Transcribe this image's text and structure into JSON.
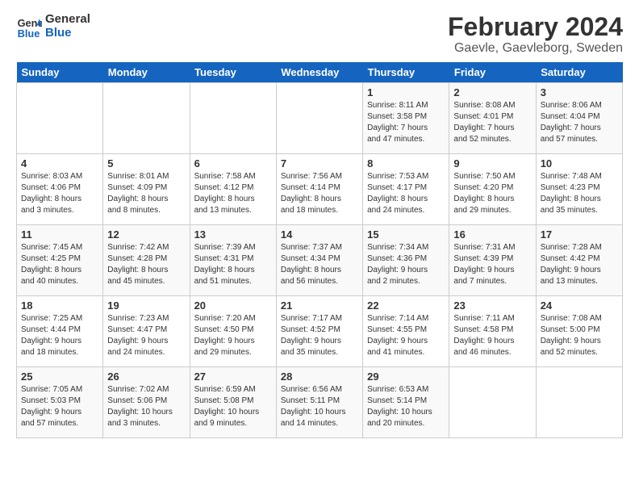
{
  "header": {
    "logo_line1": "General",
    "logo_line2": "Blue",
    "month": "February 2024",
    "location": "Gaevle, Gaevleborg, Sweden"
  },
  "weekdays": [
    "Sunday",
    "Monday",
    "Tuesday",
    "Wednesday",
    "Thursday",
    "Friday",
    "Saturday"
  ],
  "weeks": [
    [
      {
        "day": "",
        "info": ""
      },
      {
        "day": "",
        "info": ""
      },
      {
        "day": "",
        "info": ""
      },
      {
        "day": "",
        "info": ""
      },
      {
        "day": "1",
        "info": "Sunrise: 8:11 AM\nSunset: 3:58 PM\nDaylight: 7 hours\nand 47 minutes."
      },
      {
        "day": "2",
        "info": "Sunrise: 8:08 AM\nSunset: 4:01 PM\nDaylight: 7 hours\nand 52 minutes."
      },
      {
        "day": "3",
        "info": "Sunrise: 8:06 AM\nSunset: 4:04 PM\nDaylight: 7 hours\nand 57 minutes."
      }
    ],
    [
      {
        "day": "4",
        "info": "Sunrise: 8:03 AM\nSunset: 4:06 PM\nDaylight: 8 hours\nand 3 minutes."
      },
      {
        "day": "5",
        "info": "Sunrise: 8:01 AM\nSunset: 4:09 PM\nDaylight: 8 hours\nand 8 minutes."
      },
      {
        "day": "6",
        "info": "Sunrise: 7:58 AM\nSunset: 4:12 PM\nDaylight: 8 hours\nand 13 minutes."
      },
      {
        "day": "7",
        "info": "Sunrise: 7:56 AM\nSunset: 4:14 PM\nDaylight: 8 hours\nand 18 minutes."
      },
      {
        "day": "8",
        "info": "Sunrise: 7:53 AM\nSunset: 4:17 PM\nDaylight: 8 hours\nand 24 minutes."
      },
      {
        "day": "9",
        "info": "Sunrise: 7:50 AM\nSunset: 4:20 PM\nDaylight: 8 hours\nand 29 minutes."
      },
      {
        "day": "10",
        "info": "Sunrise: 7:48 AM\nSunset: 4:23 PM\nDaylight: 8 hours\nand 35 minutes."
      }
    ],
    [
      {
        "day": "11",
        "info": "Sunrise: 7:45 AM\nSunset: 4:25 PM\nDaylight: 8 hours\nand 40 minutes."
      },
      {
        "day": "12",
        "info": "Sunrise: 7:42 AM\nSunset: 4:28 PM\nDaylight: 8 hours\nand 45 minutes."
      },
      {
        "day": "13",
        "info": "Sunrise: 7:39 AM\nSunset: 4:31 PM\nDaylight: 8 hours\nand 51 minutes."
      },
      {
        "day": "14",
        "info": "Sunrise: 7:37 AM\nSunset: 4:34 PM\nDaylight: 8 hours\nand 56 minutes."
      },
      {
        "day": "15",
        "info": "Sunrise: 7:34 AM\nSunset: 4:36 PM\nDaylight: 9 hours\nand 2 minutes."
      },
      {
        "day": "16",
        "info": "Sunrise: 7:31 AM\nSunset: 4:39 PM\nDaylight: 9 hours\nand 7 minutes."
      },
      {
        "day": "17",
        "info": "Sunrise: 7:28 AM\nSunset: 4:42 PM\nDaylight: 9 hours\nand 13 minutes."
      }
    ],
    [
      {
        "day": "18",
        "info": "Sunrise: 7:25 AM\nSunset: 4:44 PM\nDaylight: 9 hours\nand 18 minutes."
      },
      {
        "day": "19",
        "info": "Sunrise: 7:23 AM\nSunset: 4:47 PM\nDaylight: 9 hours\nand 24 minutes."
      },
      {
        "day": "20",
        "info": "Sunrise: 7:20 AM\nSunset: 4:50 PM\nDaylight: 9 hours\nand 29 minutes."
      },
      {
        "day": "21",
        "info": "Sunrise: 7:17 AM\nSunset: 4:52 PM\nDaylight: 9 hours\nand 35 minutes."
      },
      {
        "day": "22",
        "info": "Sunrise: 7:14 AM\nSunset: 4:55 PM\nDaylight: 9 hours\nand 41 minutes."
      },
      {
        "day": "23",
        "info": "Sunrise: 7:11 AM\nSunset: 4:58 PM\nDaylight: 9 hours\nand 46 minutes."
      },
      {
        "day": "24",
        "info": "Sunrise: 7:08 AM\nSunset: 5:00 PM\nDaylight: 9 hours\nand 52 minutes."
      }
    ],
    [
      {
        "day": "25",
        "info": "Sunrise: 7:05 AM\nSunset: 5:03 PM\nDaylight: 9 hours\nand 57 minutes."
      },
      {
        "day": "26",
        "info": "Sunrise: 7:02 AM\nSunset: 5:06 PM\nDaylight: 10 hours\nand 3 minutes."
      },
      {
        "day": "27",
        "info": "Sunrise: 6:59 AM\nSunset: 5:08 PM\nDaylight: 10 hours\nand 9 minutes."
      },
      {
        "day": "28",
        "info": "Sunrise: 6:56 AM\nSunset: 5:11 PM\nDaylight: 10 hours\nand 14 minutes."
      },
      {
        "day": "29",
        "info": "Sunrise: 6:53 AM\nSunset: 5:14 PM\nDaylight: 10 hours\nand 20 minutes."
      },
      {
        "day": "",
        "info": ""
      },
      {
        "day": "",
        "info": ""
      }
    ]
  ]
}
